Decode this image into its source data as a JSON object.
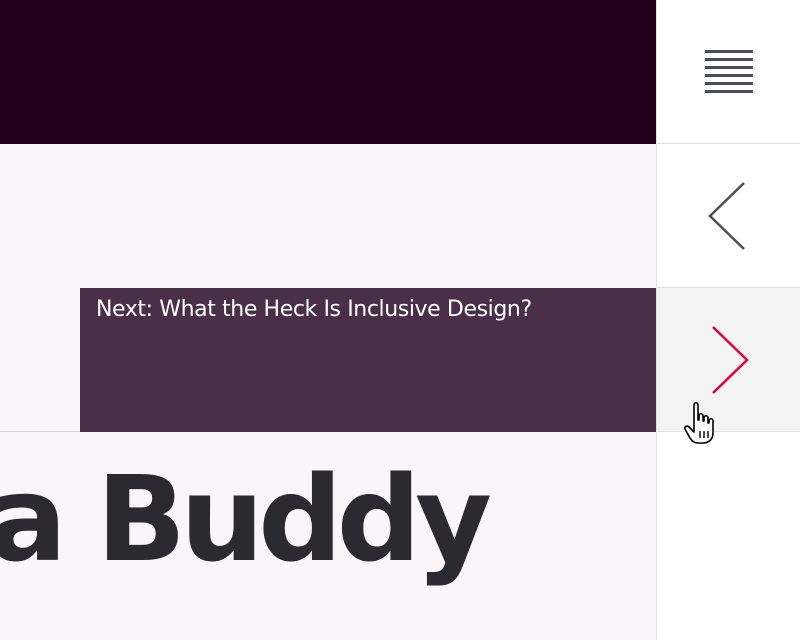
{
  "tooltip": {
    "next_label": "Next: What the Heck Is Inclusive Design?"
  },
  "article": {
    "heading_fragment": "n a Buddy"
  },
  "nav": {
    "menu_icon": "hamburger-menu-icon",
    "prev_icon": "chevron-left-icon",
    "next_icon": "chevron-right-icon"
  },
  "colors": {
    "banner": "#22001b",
    "tooltip_bg": "#4a2f48",
    "content_bg": "#faf5f9",
    "heading_text": "#2b2a30",
    "icon_gray": "#4d4c5c",
    "accent_red": "#e4003b"
  }
}
